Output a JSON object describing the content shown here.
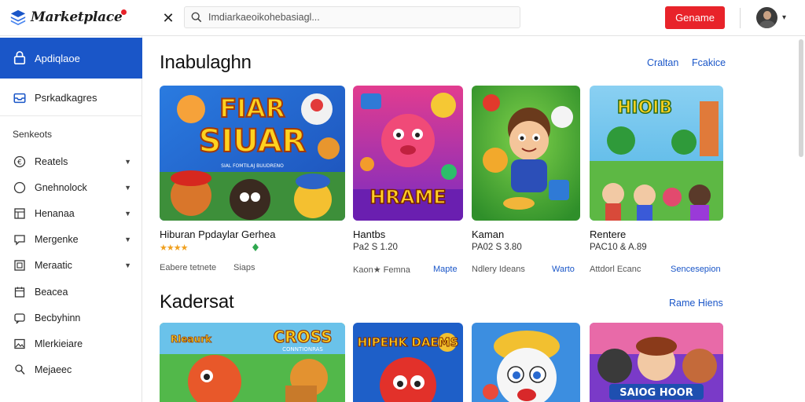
{
  "header": {
    "logo_text": "Marketplace",
    "search_placeholder": "Imdiarkaeoikohebasiagl...",
    "cta_label": "Gename"
  },
  "sidebar": {
    "active_item": "Apdiqlaoe",
    "second_item": "Psrkadkagres",
    "section_heading": "Senkeots",
    "items": [
      {
        "label": "Reatels",
        "icon": "currency-icon",
        "has_caret": true
      },
      {
        "label": "Gnehnolock",
        "icon": "circle-icon",
        "has_caret": true
      },
      {
        "label": "Henanaa",
        "icon": "grid-icon",
        "has_caret": true
      },
      {
        "label": "Mergenke",
        "icon": "chat-icon",
        "has_caret": true
      },
      {
        "label": "Meraatic",
        "icon": "square-icon",
        "has_caret": true
      },
      {
        "label": "Beacea",
        "icon": "calendar-icon",
        "has_caret": false
      },
      {
        "label": "Becbyhinn",
        "icon": "message-icon",
        "has_caret": false
      },
      {
        "label": "Mlerkieiare",
        "icon": "image-icon",
        "has_caret": false
      },
      {
        "label": "Mejaeec",
        "icon": "user-icon",
        "has_caret": false
      }
    ]
  },
  "section1": {
    "title": "Inabulaghn",
    "links": [
      "Craltan",
      "Fcakice"
    ],
    "cards": [
      {
        "title": "Hiburan Ppdaylar Gerhea",
        "thumb_text_top": "FIAR",
        "thumb_text_bottom": "SIUAR",
        "thumb_caption": "SIAL FOMTILAJ BUUDRENO",
        "rating": "★★★★",
        "meta": "Eabere tetnete",
        "link": "Siaps"
      },
      {
        "title": "Hantbs",
        "price": "Pa2 S 1.20",
        "thumb_text": "HRAME",
        "meta": "Kaon★ Femna",
        "link": "Mapte"
      },
      {
        "title": "Kaman",
        "price": "PA02 S 3.80",
        "meta": "Ndlery Ideans",
        "link": "Warto"
      },
      {
        "title": "Rentere",
        "price": "PAC10 & A.89",
        "thumb_text": "HIOIB",
        "meta": "Attdorl Ecanc",
        "link": "Sencesepion"
      }
    ]
  },
  "section2": {
    "title": "Kadersat",
    "link": "Rame Hiens",
    "cards": [
      {
        "thumb_text": "CROSS",
        "thumb_sub": "CONNTIONRAS",
        "thumb_tag": "Rleaurk"
      },
      {
        "thumb_text": "HIPEHK DAEMS"
      },
      {},
      {
        "thumb_text": "SAIOG HOOR"
      }
    ]
  },
  "colors": {
    "accent": "#1a56c8",
    "cta": "#e8232a"
  }
}
